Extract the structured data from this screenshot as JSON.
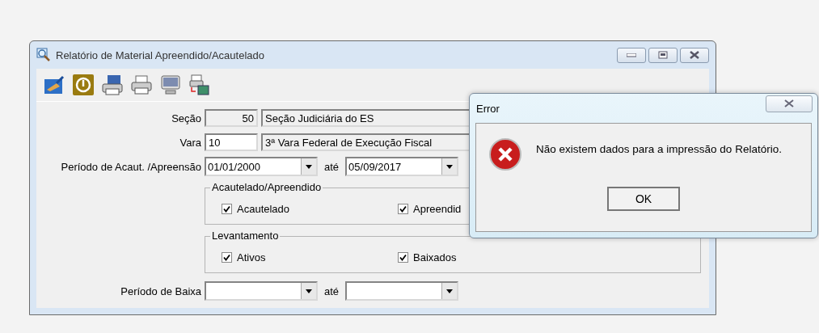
{
  "window": {
    "title": "Relatório de Material Apreendido/Acautelado"
  },
  "form": {
    "secao": {
      "label": "Seção",
      "code": "50",
      "code_disabled": true,
      "description": "Seção Judiciária do ES"
    },
    "vara": {
      "label": "Vara",
      "code": "10",
      "code_disabled": false,
      "description": "3ª Vara Federal de Execução Fiscal"
    },
    "periodo_acautelamento": {
      "label": "Período de Acaut. /Apreensão",
      "from": "01/01/2000",
      "to_label": "até",
      "to": "05/09/2017"
    },
    "groups": [
      {
        "title": "Acautelado/Apreendido",
        "options": [
          {
            "label": "Acautelado",
            "checked": true
          },
          {
            "label": "Apreendid",
            "checked": true
          }
        ]
      },
      {
        "title": "Levantamento",
        "options": [
          {
            "label": "Ativos",
            "checked": true
          },
          {
            "label": "Baixados",
            "checked": true
          }
        ]
      }
    ],
    "periodo_baixa": {
      "label": "Período de Baixa",
      "to_label": "até"
    }
  },
  "dialog": {
    "title": "Error",
    "message": "Não existem dados para a impressão do Relatório.",
    "button": "OK"
  }
}
